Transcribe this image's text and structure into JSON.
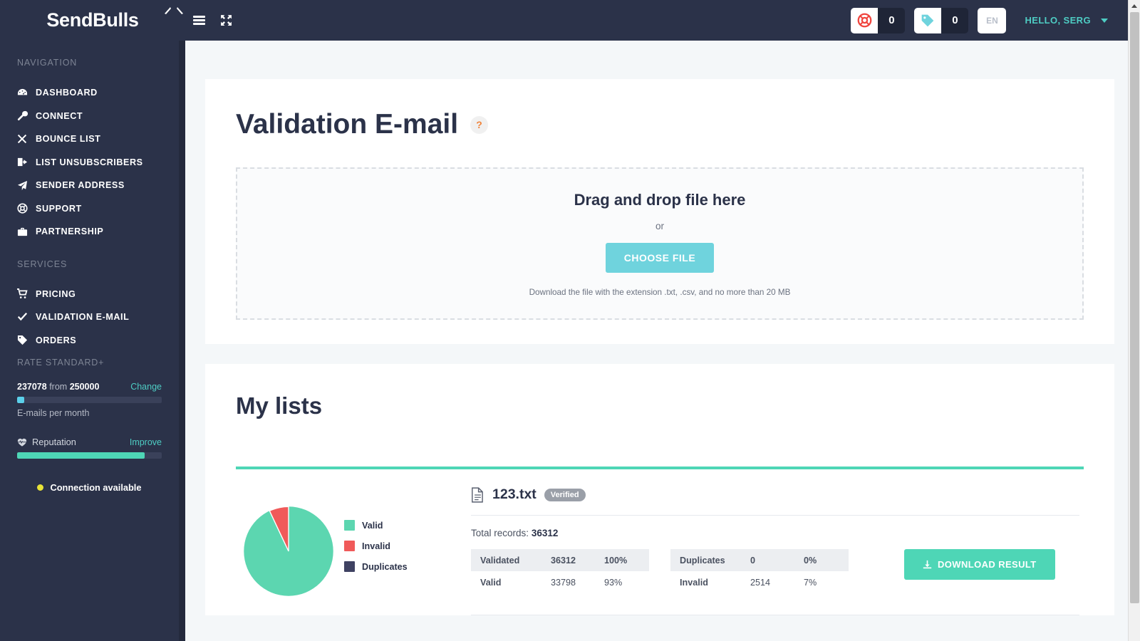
{
  "header": {
    "logo_text": "SendBulls",
    "menu_icon": "hamburger-icon",
    "fullscreen_icon": "expand-arrows-icon",
    "support_counter": {
      "icon": "life-ring-icon",
      "value": "0"
    },
    "tag_counter": {
      "icon": "tag-icon",
      "value": "0"
    },
    "language": "EN",
    "user_greeting": "HELLO, SERG"
  },
  "sidebar": {
    "nav_heading": "NAVIGATION",
    "nav_items": [
      {
        "label": "DASHBOARD",
        "icon": "dashboard-gauge-icon"
      },
      {
        "label": "CONNECT",
        "icon": "wrench-icon"
      },
      {
        "label": "BOUNCE LIST",
        "icon": "times-icon"
      },
      {
        "label": "LIST UNSUBSCRIBERS",
        "icon": "sign-out-icon"
      },
      {
        "label": "SENDER ADDRESS",
        "icon": "paper-plane-icon"
      },
      {
        "label": "SUPPORT",
        "icon": "life-ring-icon"
      },
      {
        "label": "PARTNERSHIP",
        "icon": "briefcase-icon"
      }
    ],
    "services_heading": "SERVICES",
    "service_items": [
      {
        "label": "PRICING",
        "icon": "shopping-cart-icon"
      },
      {
        "label": "VALIDATION E-MAIL",
        "icon": "check-icon"
      },
      {
        "label": "ORDERS",
        "icon": "tag-icon"
      }
    ],
    "rate": {
      "title": "RATE STANDARD+",
      "used": "237078",
      "from_word": "from",
      "total": "250000",
      "change_link": "Change",
      "usage_caption": "E-mails per month",
      "usage_percent": 5,
      "usage_color": "#5bd0ea",
      "reputation_label": "Reputation",
      "reputation_icon": "heartbeat-icon",
      "improve_link": "Improve",
      "reputation_percent": 88,
      "reputation_color": "#4ed6b6",
      "connection_status": "Connection available",
      "connection_dot_color": "#e8e337"
    }
  },
  "main": {
    "page_title": "Validation E-mail",
    "help_icon_label": "?",
    "upload": {
      "title": "Drag and drop file here",
      "or": "or",
      "button": "CHOOSE FILE",
      "note": "Download the file with the extension .txt, .csv, and no more than 20 MB"
    },
    "lists": {
      "title": "My lists",
      "items": [
        {
          "file_icon": "file-text-icon",
          "file_name": "123.txt",
          "status_badge": "Verified",
          "total_label": "Total records:",
          "total_value": "36312",
          "stats_left": [
            {
              "label": "Validated",
              "count": "36312",
              "percent": "100%"
            },
            {
              "label": "Valid",
              "count": "33798",
              "percent": "93%"
            }
          ],
          "stats_right": [
            {
              "label": "Duplicates",
              "count": "0",
              "percent": "0%"
            },
            {
              "label": "Invalid",
              "count": "2514",
              "percent": "7%"
            }
          ],
          "download_button": "DOWNLOAD RESULT",
          "download_icon": "download-icon"
        }
      ]
    }
  },
  "chart_data": {
    "type": "pie",
    "title": "",
    "categories": [
      "Valid",
      "Invalid",
      "Duplicates"
    ],
    "values": [
      93,
      7,
      0
    ],
    "counts": [
      33798,
      2514,
      0
    ],
    "colors": [
      "#5cd6b0",
      "#f05a5a",
      "#3f4262"
    ],
    "legend": [
      "Valid",
      "Invalid",
      "Duplicates"
    ],
    "legend_position": "right",
    "total": 36312,
    "unit": "%"
  }
}
